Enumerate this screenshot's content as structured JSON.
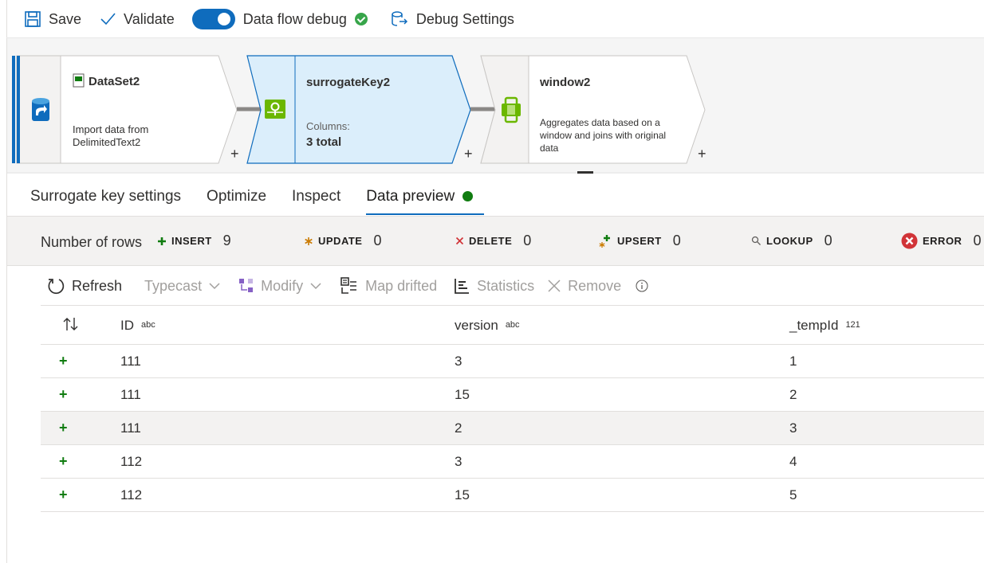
{
  "toolbar": {
    "save_label": "Save",
    "validate_label": "Validate",
    "debug_label": "Data flow debug",
    "debug_settings_label": "Debug Settings",
    "debug_on": true
  },
  "nodes": {
    "source": {
      "title": "DataSet2",
      "description": [
        "Import data from",
        "DelimitedText2"
      ]
    },
    "surrogate": {
      "title": "surrogateKey2",
      "columns_label": "Columns:",
      "columns_value": "3 total"
    },
    "window": {
      "title": "window2",
      "description": [
        "Aggregates data based on a",
        "window and joins with original",
        "data"
      ]
    },
    "plus": "+"
  },
  "tabs": [
    {
      "label": "Surrogate key settings",
      "active": false
    },
    {
      "label": "Optimize",
      "active": false
    },
    {
      "label": "Inspect",
      "active": false
    },
    {
      "label": "Data preview",
      "active": true
    }
  ],
  "summary": {
    "label": "Number of rows",
    "items": [
      {
        "label": "INSERT",
        "value": "9",
        "icon": "plus-icon"
      },
      {
        "label": "UPDATE",
        "value": "0",
        "icon": "asterisk-icon"
      },
      {
        "label": "DELETE",
        "value": "0",
        "icon": "x-icon"
      },
      {
        "label": "UPSERT",
        "value": "0",
        "icon": "upsert-icon"
      },
      {
        "label": "LOOKUP",
        "value": "0",
        "icon": "search-icon"
      },
      {
        "label": "ERROR",
        "value": "0",
        "icon": "error-icon"
      }
    ]
  },
  "actions": {
    "refresh": "Refresh",
    "typecast": "Typecast",
    "modify": "Modify",
    "map_drifted": "Map drifted",
    "statistics": "Statistics",
    "remove": "Remove"
  },
  "table": {
    "columns": [
      {
        "name": "ID",
        "type": "abc"
      },
      {
        "name": "version",
        "type": "abc"
      },
      {
        "name": "_tempId",
        "type": "121"
      }
    ],
    "rows": [
      {
        "flag": "+",
        "cells": [
          "111",
          "3",
          "1"
        ]
      },
      {
        "flag": "+",
        "cells": [
          "111",
          "15",
          "2"
        ]
      },
      {
        "flag": "+",
        "cells": [
          "111",
          "2",
          "3"
        ]
      },
      {
        "flag": "+",
        "cells": [
          "112",
          "3",
          "4"
        ]
      },
      {
        "flag": "+",
        "cells": [
          "112",
          "15",
          "5"
        ]
      }
    ]
  },
  "colors": {
    "accent": "#0f6cbd",
    "success": "#107c10",
    "selected_node": "#dbeefb"
  }
}
